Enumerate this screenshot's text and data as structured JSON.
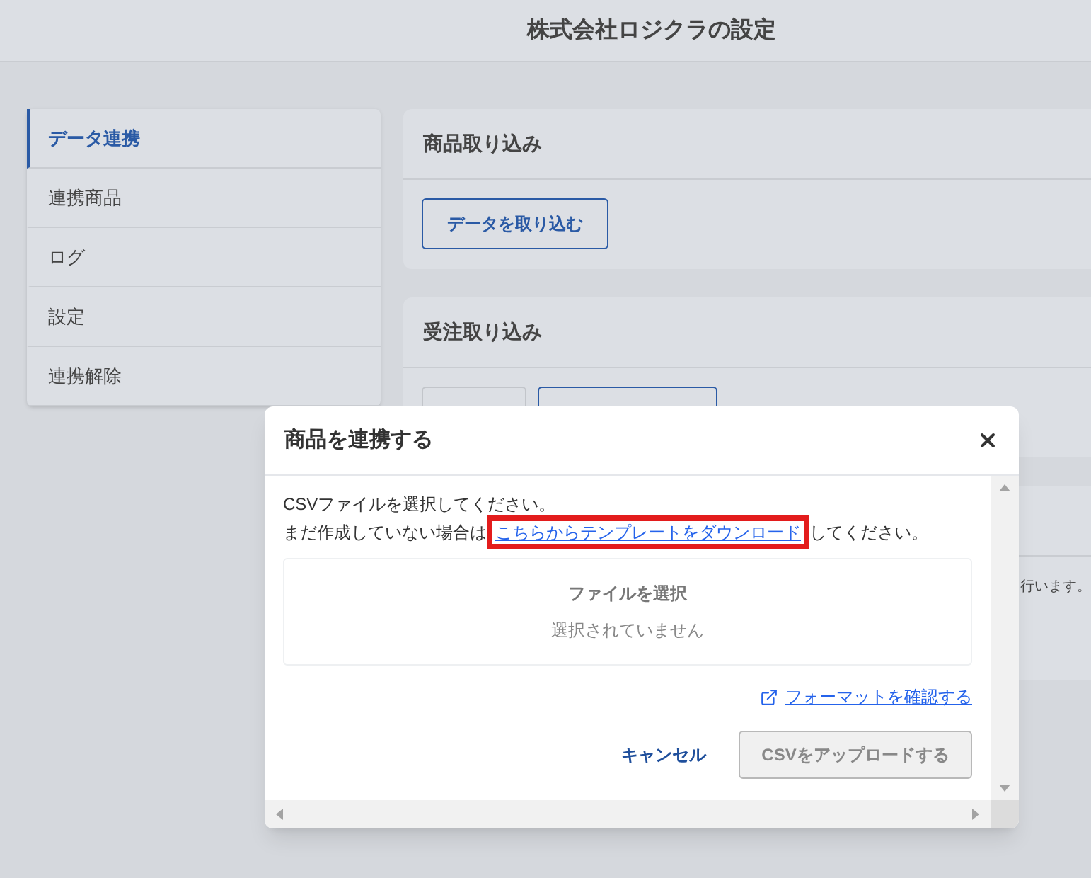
{
  "header": {
    "title": "株式会社ロジクラの設定"
  },
  "sidebar": {
    "items": [
      {
        "label": "データ連携",
        "selected": true
      },
      {
        "label": "連携商品",
        "selected": false
      },
      {
        "label": "ログ",
        "selected": false
      },
      {
        "label": "設定",
        "selected": false
      },
      {
        "label": "連携解除",
        "selected": false
      }
    ]
  },
  "cards": [
    {
      "title": "商品取り込み",
      "button": "データを取り込む"
    },
    {
      "title": "受注取り込み"
    },
    {
      "text": "行います。"
    }
  ],
  "dialog": {
    "title": "商品を連携する",
    "line1": "CSVファイルを選択してください。",
    "line2_before": "まだ作成していない場合は",
    "link": "こちらからテンプレートをダウンロード",
    "line2_after": "してください。",
    "highlighted": true,
    "file_button": "ファイルを選択",
    "file_status": "選択されていません",
    "format_link": "フォーマットを確認する",
    "cancel": "キャンセル",
    "upload": {
      "label": "CSVをアップロードする",
      "disabled": true
    }
  }
}
